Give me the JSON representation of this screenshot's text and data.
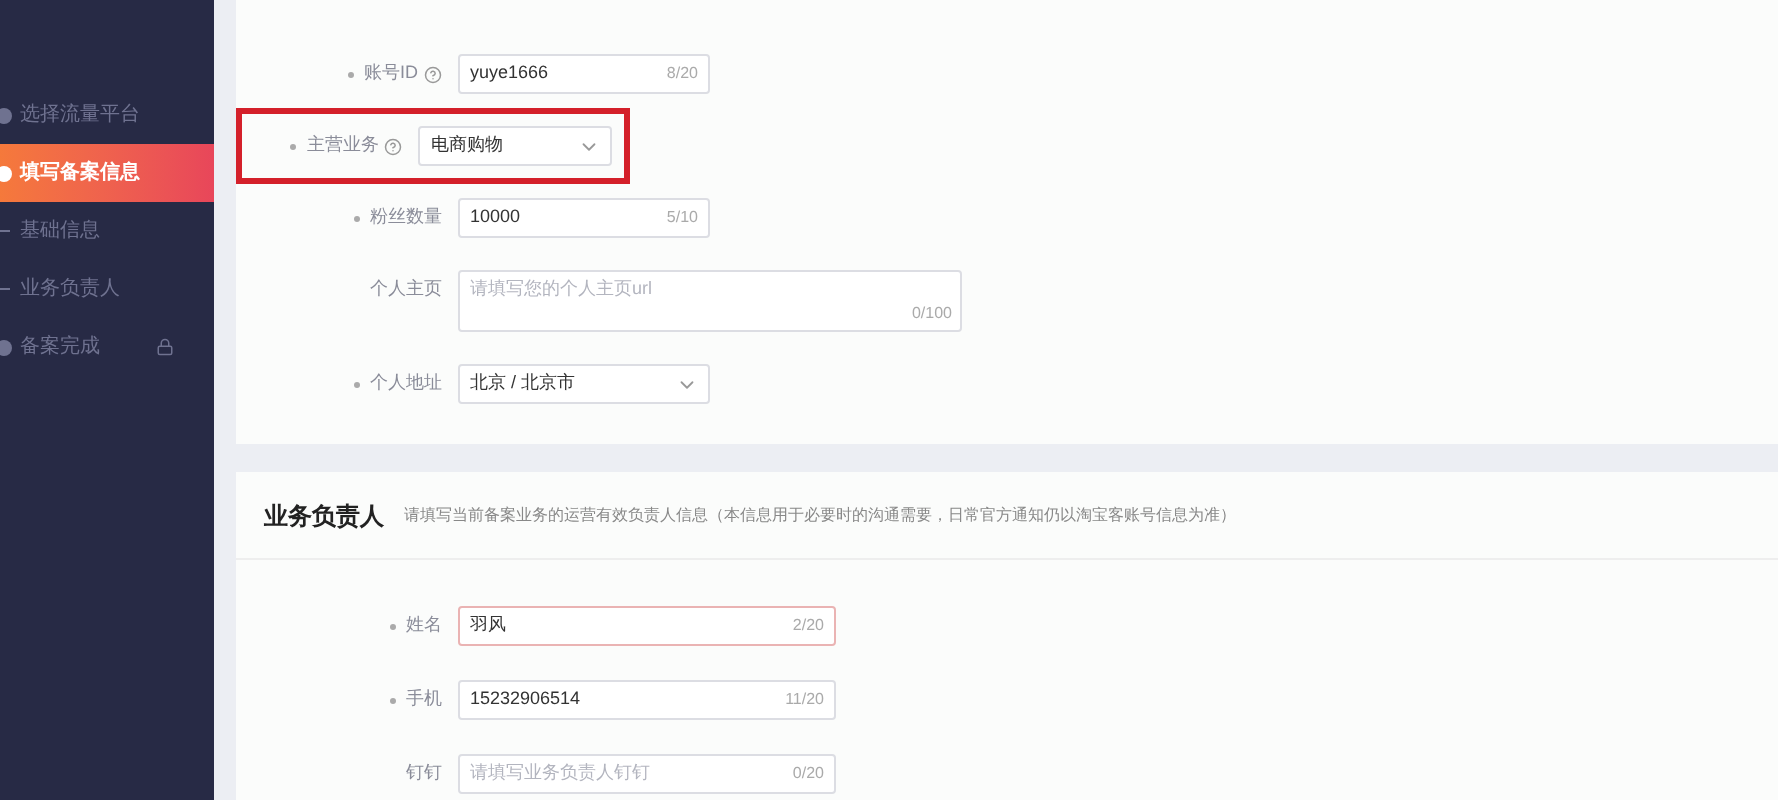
{
  "sidebar": {
    "items": [
      {
        "label": "选择流量平台",
        "kind": "step",
        "selected": false,
        "locked": false
      },
      {
        "label": "填写备案信息",
        "kind": "step",
        "selected": true,
        "locked": false
      },
      {
        "label": "基础信息",
        "kind": "substep",
        "selected": false,
        "locked": false
      },
      {
        "label": "业务负责人",
        "kind": "substep",
        "selected": false,
        "locked": false
      },
      {
        "label": "备案完成",
        "kind": "step",
        "selected": false,
        "locked": true
      }
    ]
  },
  "basic_form": {
    "fields": [
      {
        "label": "账号ID",
        "required": true,
        "help": true,
        "kind": "input",
        "value": "yuye1666",
        "counter": "8/20",
        "highlighted": false,
        "error": false
      },
      {
        "label": "主营业务",
        "required": true,
        "help": true,
        "kind": "select",
        "value": "电商购物",
        "highlighted": true,
        "error": false
      },
      {
        "label": "粉丝数量",
        "required": true,
        "help": false,
        "kind": "input",
        "value": "10000",
        "counter": "5/10",
        "highlighted": false,
        "error": false
      },
      {
        "label": "个人主页",
        "required": false,
        "help": false,
        "kind": "textarea",
        "placeholder": "请填写您的个人主页url",
        "counter": "0/100",
        "highlighted": false,
        "error": false
      },
      {
        "label": "个人地址",
        "required": true,
        "help": false,
        "kind": "select",
        "value": "北京 / 北京市",
        "highlighted": false,
        "error": false
      }
    ]
  },
  "owner_section": {
    "title": "业务负责人",
    "description": "请填写当前备案业务的运营有效负责人信息（本信息用于必要时的沟通需要，日常官方通知仍以淘宝客账号信息为准）",
    "fields": [
      {
        "label": "姓名",
        "required": true,
        "help": false,
        "value": "羽风",
        "counter": "2/20",
        "highlighted": false,
        "error": true
      },
      {
        "label": "手机",
        "required": true,
        "help": false,
        "value": "15232906514",
        "counter": "11/20",
        "highlighted": false,
        "error": false
      },
      {
        "label": "钉钉",
        "required": false,
        "help": false,
        "placeholder": "请填写业务负责人钉钉",
        "counter": "0/20",
        "highlighted": false,
        "error": false
      }
    ]
  }
}
